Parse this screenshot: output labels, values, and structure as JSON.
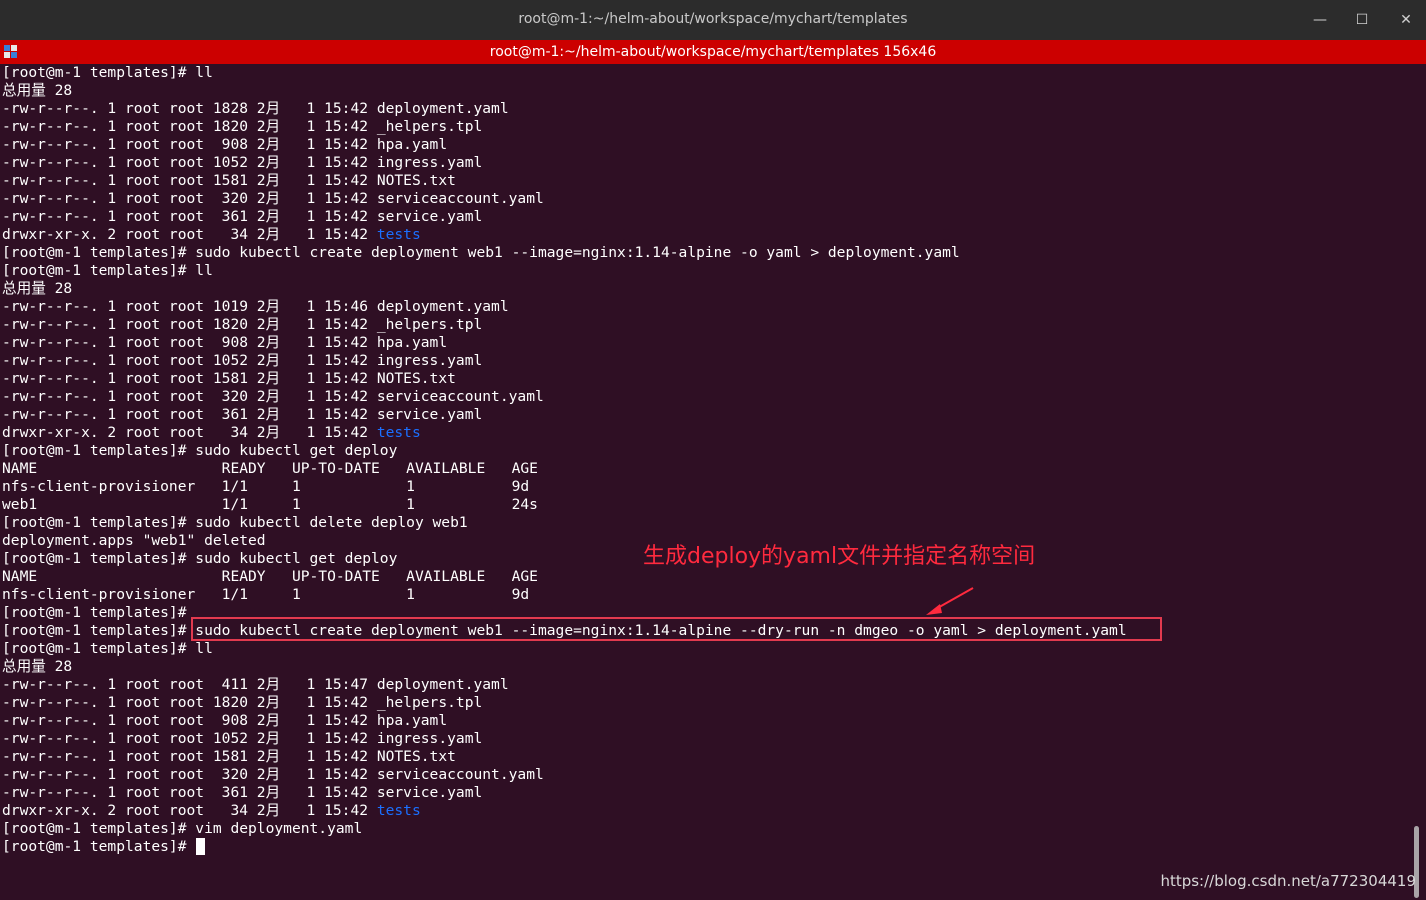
{
  "window": {
    "title": "root@m-1:~/helm-about/workspace/mychart/templates",
    "tab_title": "root@m-1:~/helm-about/workspace/mychart/templates 156x46",
    "minimize_glyph": "—",
    "maximize_glyph": "☐",
    "close_glyph": "✕"
  },
  "terminal": {
    "lines": [
      {
        "text": "[root@m-1 templates]# ll"
      },
      {
        "text": "总用量 28"
      },
      {
        "text": "-rw-r--r--. 1 root root 1828 2月   1 15:42 deployment.yaml"
      },
      {
        "text": "-rw-r--r--. 1 root root 1820 2月   1 15:42 _helpers.tpl"
      },
      {
        "text": "-rw-r--r--. 1 root root  908 2月   1 15:42 hpa.yaml"
      },
      {
        "text": "-rw-r--r--. 1 root root 1052 2月   1 15:42 ingress.yaml"
      },
      {
        "text": "-rw-r--r--. 1 root root 1581 2月   1 15:42 NOTES.txt"
      },
      {
        "text": "-rw-r--r--. 1 root root  320 2月   1 15:42 serviceaccount.yaml"
      },
      {
        "text": "-rw-r--r--. 1 root root  361 2月   1 15:42 service.yaml"
      },
      {
        "text": "drwxr-xr-x. 2 root root   34 2月   1 15:42 ",
        "dir": "tests"
      },
      {
        "text": "[root@m-1 templates]# sudo kubectl create deployment web1 --image=nginx:1.14-alpine -o yaml > deployment.yaml"
      },
      {
        "text": "[root@m-1 templates]# ll"
      },
      {
        "text": "总用量 28"
      },
      {
        "text": "-rw-r--r--. 1 root root 1019 2月   1 15:46 deployment.yaml"
      },
      {
        "text": "-rw-r--r--. 1 root root 1820 2月   1 15:42 _helpers.tpl"
      },
      {
        "text": "-rw-r--r--. 1 root root  908 2月   1 15:42 hpa.yaml"
      },
      {
        "text": "-rw-r--r--. 1 root root 1052 2月   1 15:42 ingress.yaml"
      },
      {
        "text": "-rw-r--r--. 1 root root 1581 2月   1 15:42 NOTES.txt"
      },
      {
        "text": "-rw-r--r--. 1 root root  320 2月   1 15:42 serviceaccount.yaml"
      },
      {
        "text": "-rw-r--r--. 1 root root  361 2月   1 15:42 service.yaml"
      },
      {
        "text": "drwxr-xr-x. 2 root root   34 2月   1 15:42 ",
        "dir": "tests"
      },
      {
        "text": "[root@m-1 templates]# sudo kubectl get deploy"
      },
      {
        "text": "NAME                     READY   UP-TO-DATE   AVAILABLE   AGE"
      },
      {
        "text": "nfs-client-provisioner   1/1     1            1           9d"
      },
      {
        "text": "web1                     1/1     1            1           24s"
      },
      {
        "text": "[root@m-1 templates]# sudo kubectl delete deploy web1"
      },
      {
        "text": "deployment.apps \"web1\" deleted"
      },
      {
        "text": "[root@m-1 templates]# sudo kubectl get deploy"
      },
      {
        "text": "NAME                     READY   UP-TO-DATE   AVAILABLE   AGE"
      },
      {
        "text": "nfs-client-provisioner   1/1     1            1           9d"
      },
      {
        "text": "[root@m-1 templates]#"
      },
      {
        "text": "[root@m-1 templates]# sudo kubectl create deployment web1 --image=nginx:1.14-alpine --dry-run -n dmgeo -o yaml > deployment.yaml"
      },
      {
        "text": "[root@m-1 templates]# ll"
      },
      {
        "text": "总用量 28"
      },
      {
        "text": "-rw-r--r--. 1 root root  411 2月   1 15:47 deployment.yaml"
      },
      {
        "text": "-rw-r--r--. 1 root root 1820 2月   1 15:42 _helpers.tpl"
      },
      {
        "text": "-rw-r--r--. 1 root root  908 2月   1 15:42 hpa.yaml"
      },
      {
        "text": "-rw-r--r--. 1 root root 1052 2月   1 15:42 ingress.yaml"
      },
      {
        "text": "-rw-r--r--. 1 root root 1581 2月   1 15:42 NOTES.txt"
      },
      {
        "text": "-rw-r--r--. 1 root root  320 2月   1 15:42 serviceaccount.yaml"
      },
      {
        "text": "-rw-r--r--. 1 root root  361 2月   1 15:42 service.yaml"
      },
      {
        "text": "drwxr-xr-x. 2 root root   34 2月   1 15:42 ",
        "dir": "tests"
      },
      {
        "text": "[root@m-1 templates]# vim deployment.yaml"
      },
      {
        "text": "[root@m-1 templates]# ",
        "cursor": true
      }
    ]
  },
  "annotation": {
    "text": "生成deploy的yaml文件并指定名称空间",
    "color": "#ff2a3e"
  },
  "watermark": "https://blog.csdn.net/a772304419",
  "colors": {
    "background": "#2f0f24",
    "tab_bar": "#cc0000",
    "directory": "#1b6fff"
  }
}
